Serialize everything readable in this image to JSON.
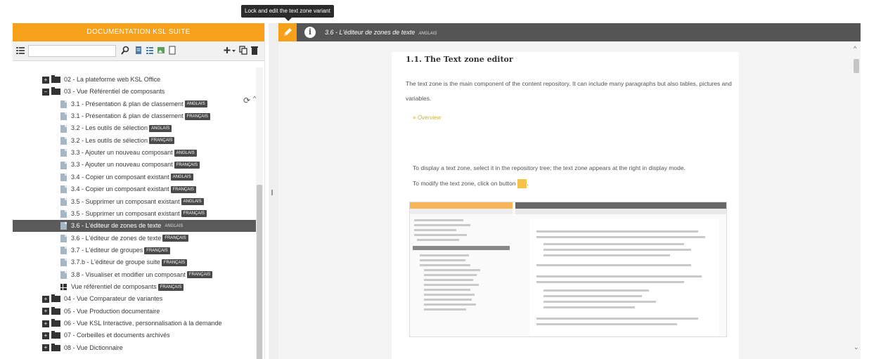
{
  "tooltip": {
    "text": "Lock and edit the text zone variant"
  },
  "sidebar": {
    "title": "DOCUMENTATION KSL SUITE",
    "search": {
      "value": "",
      "placeholder": ""
    },
    "tree": [
      {
        "id": "n1",
        "kind": "folder",
        "expanded": false,
        "label": "02 - La plateforme web KSL Office",
        "badge": ""
      },
      {
        "id": "n2",
        "kind": "folder",
        "expanded": true,
        "label": "03 - Vue Référentiel de composants",
        "badge": ""
      },
      {
        "id": "n3",
        "kind": "doc",
        "label": "3.1 - Présentation & plan de classement",
        "badge": "ANGLAIS"
      },
      {
        "id": "n4",
        "kind": "doc",
        "label": "3.1 - Présentation & plan de classement",
        "badge": "FRANÇAIS"
      },
      {
        "id": "n5",
        "kind": "doc",
        "label": "3.2 - Les outils de sélection",
        "badge": "ANGLAIS"
      },
      {
        "id": "n6",
        "kind": "doc",
        "label": "3.2 - Les outils de sélection",
        "badge": "FRANÇAIS"
      },
      {
        "id": "n7",
        "kind": "doc",
        "label": "3.3 - Ajouter un nouveau composant",
        "badge": "ANGLAIS"
      },
      {
        "id": "n8",
        "kind": "doc",
        "label": "3.3 - Ajouter un nouveau composant",
        "badge": "FRANÇAIS"
      },
      {
        "id": "n9",
        "kind": "doc",
        "label": "3.4 - Copier un composant existant",
        "badge": "ANGLAIS"
      },
      {
        "id": "n10",
        "kind": "doc",
        "label": "3.4 - Copier un composant existant",
        "badge": "FRANÇAIS"
      },
      {
        "id": "n11",
        "kind": "doc",
        "label": "3.5 - Supprimer un composant existant",
        "badge": "ANGLAIS"
      },
      {
        "id": "n12",
        "kind": "doc",
        "label": "3.5 - Supprimer un composant existant",
        "badge": "FRANÇAIS"
      },
      {
        "id": "n13",
        "kind": "doc",
        "label": "3.6 - L'éditeur de zones de texte",
        "badge": "ANGLAIS",
        "selected": true
      },
      {
        "id": "n14",
        "kind": "doc",
        "label": "3.6 - L'éditeur de zones de texte",
        "badge": "FRANÇAIS"
      },
      {
        "id": "n15",
        "kind": "doc",
        "label": "3.7 - L'éditeur de groupes",
        "badge": "FRANÇAIS"
      },
      {
        "id": "n16",
        "kind": "doc",
        "label": "3.7.b - L'éditeur de groupe suite",
        "badge": "FRANÇAIS"
      },
      {
        "id": "n17",
        "kind": "doc",
        "label": "3.8 - Visualiser et modifier un composant",
        "badge": "FRANÇAIS"
      },
      {
        "id": "n18",
        "kind": "grid",
        "label": "Vue référentiel de composants",
        "badge": "FRANÇAIS"
      },
      {
        "id": "n19",
        "kind": "folder",
        "expanded": false,
        "label": "04 - Vue Comparateur de variantes",
        "badge": ""
      },
      {
        "id": "n20",
        "kind": "folder",
        "expanded": false,
        "label": "05 - Vue Production documentaire",
        "badge": ""
      },
      {
        "id": "n21",
        "kind": "folder",
        "expanded": false,
        "label": "06 - Vue KSL Interactive, personnalisation à la demande",
        "badge": ""
      },
      {
        "id": "n22",
        "kind": "folder",
        "expanded": false,
        "label": "07 - Corbeilles et documents archivés",
        "badge": ""
      },
      {
        "id": "n23",
        "kind": "folder",
        "expanded": false,
        "label": "08 - Vue Dictionnaire",
        "badge": ""
      }
    ]
  },
  "viewer": {
    "title": "3.6 - L'éditeur de zones de texte",
    "language_tag": "ANGLAIS",
    "heading": "1.1. The Text zone editor",
    "paragraph": "The text zone is the main component of the content repository. It can include many paragraphs but also tables, pictures and variables.",
    "overview_label": "Overview",
    "display_text": "To display a text zone, select it in the repository tree; the text zone appears at the right in display mode.",
    "modify_text": "To modify the text zone, click on button"
  },
  "colors": {
    "accent": "#f7a11a",
    "header_dark": "#555555",
    "selected_row": "#5a5a5a"
  }
}
